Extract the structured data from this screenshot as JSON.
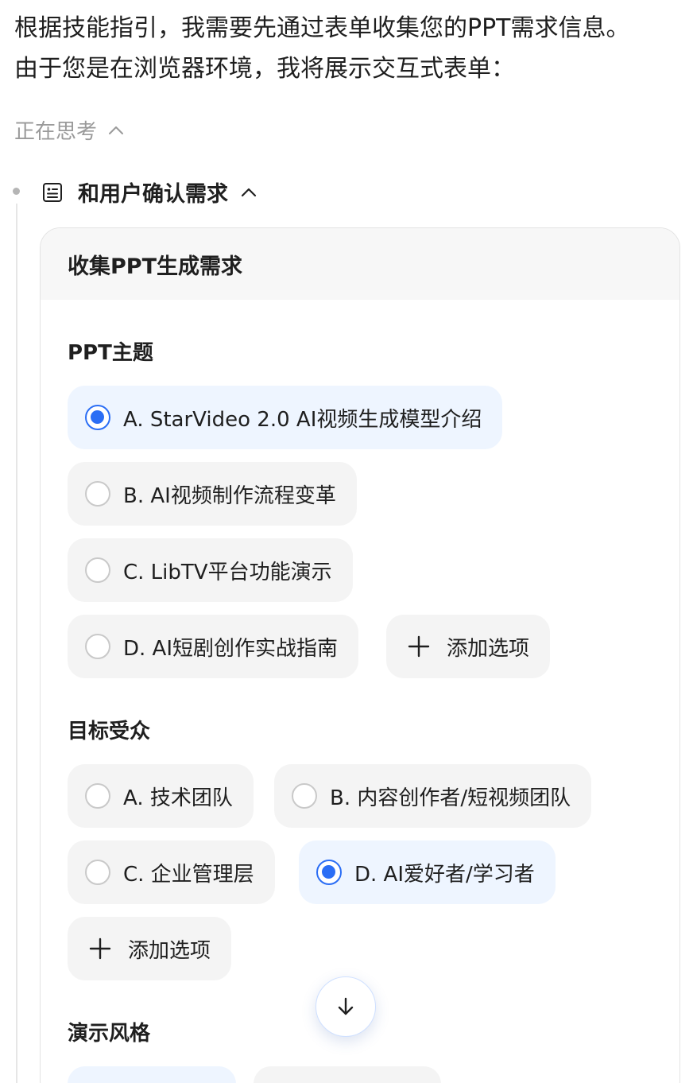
{
  "intro_text": "根据技能指引，我需要先通过表单收集您的PPT需求信息。由于您是在浏览器环境，我将展示交互式表单：",
  "thinking_label": "正在思考",
  "step": {
    "label": "和用户确认需求"
  },
  "form": {
    "title": "收集PPT生成需求",
    "sections": [
      {
        "title": "PPT主题",
        "options": [
          {
            "label": "A. StarVideo 2.0 AI视频生成模型介绍",
            "selected": true
          },
          {
            "label": "B. AI视频制作流程变革",
            "selected": false
          },
          {
            "label": "C. LibTV平台功能演示",
            "selected": false
          },
          {
            "label": "D. AI短剧创作实战指南",
            "selected": false
          }
        ],
        "add_option_label": "添加选项"
      },
      {
        "title": "目标受众",
        "options": [
          {
            "label": "A. 技术团队",
            "selected": false
          },
          {
            "label": "B. 内容创作者/短视频团队",
            "selected": false
          },
          {
            "label": "C. 企业管理层",
            "selected": false
          },
          {
            "label": "D. AI爱好者/学习者",
            "selected": true
          }
        ],
        "add_option_label": "添加选项"
      },
      {
        "title": "演示风格"
      }
    ]
  },
  "colors": {
    "accent": "#2b6ef5",
    "selected_bg": "#eef5ff",
    "option_bg": "#f4f4f4"
  },
  "icons": {
    "thinking_toggle": "chevron-up-icon",
    "step": "form-icon",
    "add": "plus-icon",
    "scroll": "arrow-down-icon"
  }
}
